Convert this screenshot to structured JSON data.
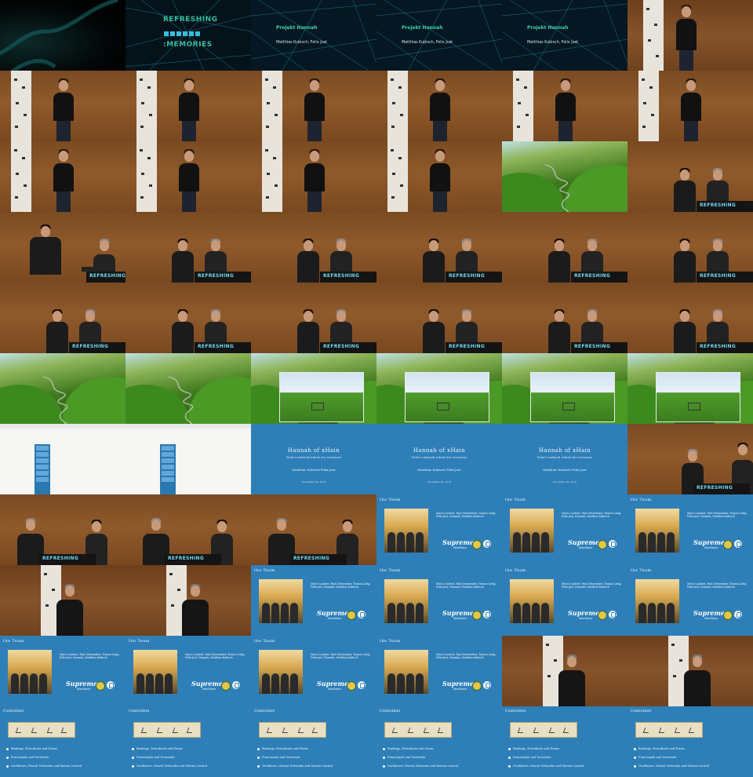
{
  "title_slide": {
    "top": "REFRESHING",
    "bottom": ":MEMORIES"
  },
  "project_slide": {
    "title": "Projekt Hannah",
    "authors": "Matthias Kubisch, Felix Just"
  },
  "podium_label": "REFRESHING",
  "blue_title_slide": {
    "title": "Hannah of xHain",
    "subtitle": "Total confused robots for everyone",
    "authors": "Matthias Kubisch      Felix Just",
    "date": "December 20, 2019"
  },
  "team_slide": {
    "title": "the Team",
    "names": "Mario Laubert, Paul Schwember, Tiomas Lutig, Felix Just, Hamzah, Matthias Kubisch",
    "supreme": "Supreme",
    "supreme_sub": "Machines"
  },
  "controllers_slide": {
    "title": "Controllers",
    "items": [
      "Bindings, Periodicals and Forms",
      "Functionals and Vectorials",
      "Oscillators, Neural Networks and Motion Control"
    ]
  },
  "colors": {
    "slide_blue": "#2e7fb8",
    "teal": "#2fbf9f",
    "wood": "#8a5428"
  },
  "tiles": [
    "dark",
    "title",
    "project",
    "project",
    "project",
    "speaker_pillar",
    "speaker",
    "speaker",
    "speaker",
    "speaker",
    "speaker",
    "speaker",
    "speaker",
    "speaker",
    "speaker",
    "speaker",
    "landscape",
    "duo",
    "duo_wide",
    "duo",
    "duo",
    "duo",
    "duo",
    "duo",
    "duo",
    "duo",
    "duo",
    "duo",
    "duo",
    "duo",
    "landscape",
    "landscape",
    "sim",
    "sim",
    "sim",
    "sim",
    "browser",
    "browser",
    "blue_title",
    "blue_title",
    "blue_title",
    "duo_right",
    "duo_bar",
    "duo_bar",
    "duo_bar",
    "team",
    "team",
    "team",
    "solo_pillar",
    "solo_pillar",
    "team",
    "team",
    "team",
    "team",
    "team",
    "team",
    "team",
    "team",
    "solo_pillar",
    "solo_pillar",
    "controllers",
    "controllers",
    "controllers",
    "controllers",
    "controllers",
    "controllers"
  ]
}
